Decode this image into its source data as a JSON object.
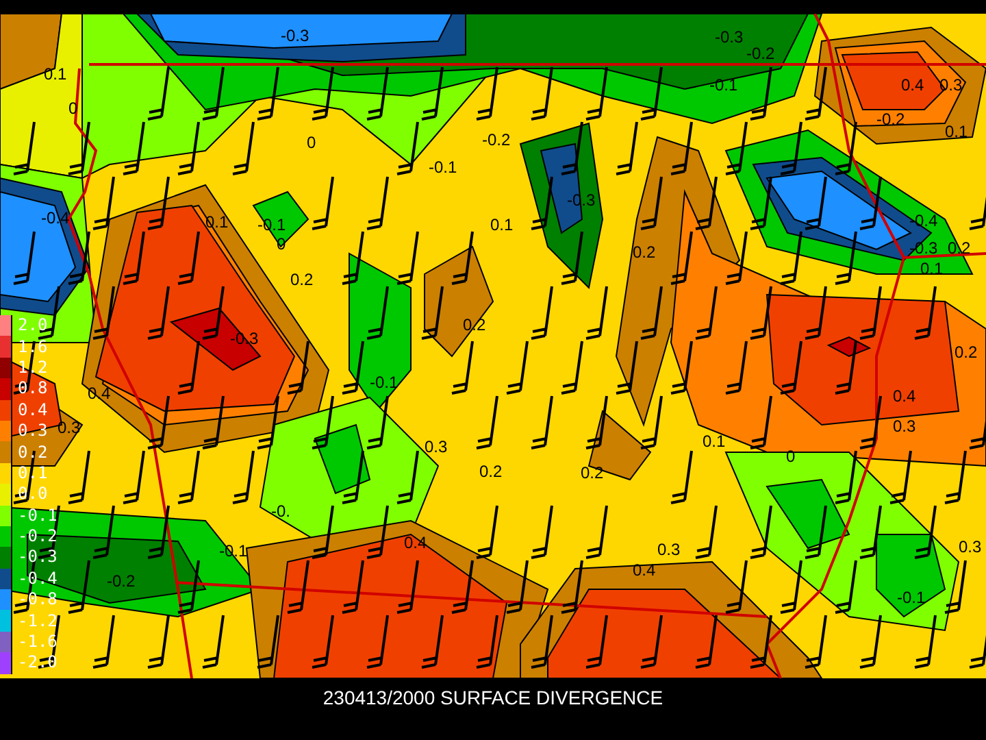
{
  "map": {
    "contour_labels": [
      "-0.3",
      "0.1",
      "0",
      "0",
      "-0.1",
      "-0.4",
      "0.1",
      "-0.1",
      "0",
      "0.2",
      "-0.3",
      "-0.3",
      "-0.2",
      "-0.1",
      "-0.2",
      "-0.3",
      "0.1",
      "0.2",
      "0.4",
      "0.3",
      "-0.2",
      "0.1",
      "-0.4",
      "-0.3",
      "0.2",
      "0.1",
      "0.2",
      "0.2",
      "0.4",
      "-0.1",
      "0.3",
      "0.4",
      "0.3",
      "0.3",
      "0.1",
      "0",
      "0.2",
      "0.2",
      "-0.",
      "-0.1",
      "0.4",
      "-0.2",
      "0.3",
      "0.4",
      "0.3",
      "-0.1"
    ]
  },
  "legend": [
    {
      "label": "2.0",
      "color": "#ff8080"
    },
    {
      "label": "1.6",
      "color": "#e83030"
    },
    {
      "label": "1.2",
      "color": "#900000"
    },
    {
      "label": "0.8",
      "color": "#c80000"
    },
    {
      "label": "0.4",
      "color": "#f04000"
    },
    {
      "label": "0.3",
      "color": "#ff8000"
    },
    {
      "label": "0.2",
      "color": "#cc8000"
    },
    {
      "label": "0.1",
      "color": "#ffd700"
    },
    {
      "label": "0.0",
      "color": "#e8f000"
    },
    {
      "label": "-0.1",
      "color": "#80ff00"
    },
    {
      "label": "-0.2",
      "color": "#00c800"
    },
    {
      "label": "-0.3",
      "color": "#008000"
    },
    {
      "label": "-0.4",
      "color": "#104c8c"
    },
    {
      "label": "-0.8",
      "color": "#1e90ff"
    },
    {
      "label": "-1.2",
      "color": "#00c0e0"
    },
    {
      "label": "-1.6",
      "color": "#8060c0"
    },
    {
      "label": "-2.0",
      "color": "#a040ff"
    }
  ],
  "caption": "230413/2000 SURFACE DIVERGENCE"
}
